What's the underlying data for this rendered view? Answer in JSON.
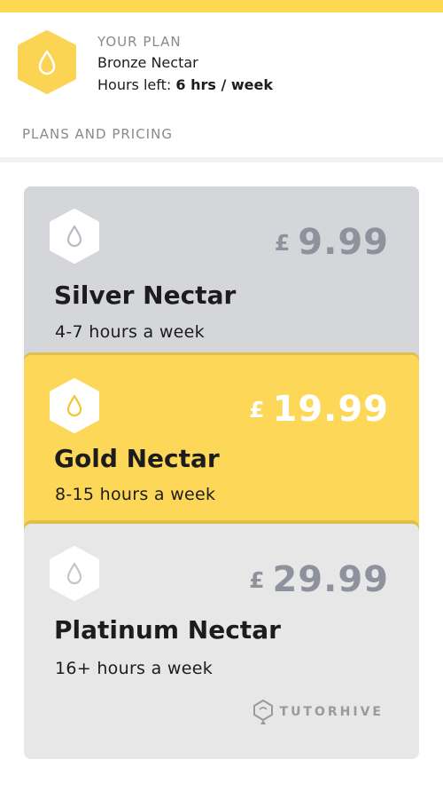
{
  "header": {
    "eyebrow": "YOUR PLAN",
    "plan_name": "Bronze Nectar",
    "hours_label": "Hours left:",
    "hours_value": "6 hrs / week",
    "badge_icon": "drop-icon"
  },
  "section": {
    "label": "PLANS AND PRICING"
  },
  "plans": [
    {
      "currency": "£",
      "price": "9.99",
      "title": "Silver Nectar",
      "hours": "4-7 hours a week",
      "icon": "drop-icon"
    },
    {
      "currency": "£",
      "price": "19.99",
      "title": "Gold Nectar",
      "hours": "8-15 hours a week",
      "icon": "drop-icon"
    },
    {
      "currency": "£",
      "price": "29.99",
      "title": "Platinum Nectar",
      "hours": "16+ hours a week",
      "icon": "drop-icon"
    }
  ],
  "brand": {
    "name": "TUTORHIVE",
    "icon": "tutorhive-logo-icon"
  },
  "colors": {
    "accent_yellow": "#fcd94f",
    "silver_card": "#d5d6da",
    "gold_card": "#fdd757",
    "platinum_card": "#e7e7e8",
    "price_grey": "#8d929c"
  }
}
